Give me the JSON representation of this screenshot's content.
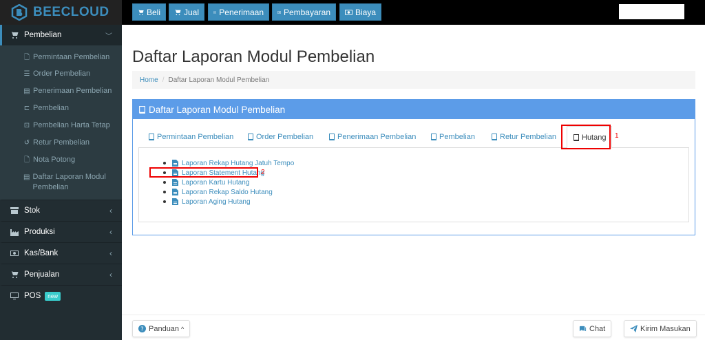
{
  "brand": "BEECLOUD",
  "topnav": [
    {
      "label": "Beli",
      "icon": "cart-icon"
    },
    {
      "label": "Jual",
      "icon": "cart-icon"
    },
    {
      "label": "Penerimaan",
      "icon": "money-icon"
    },
    {
      "label": "Pembayaran",
      "icon": "money-icon"
    },
    {
      "label": "Biaya",
      "icon": "money-icon"
    }
  ],
  "sidebar": {
    "active": {
      "label": "Pembelian",
      "chevron": "﹀"
    },
    "sub": [
      {
        "label": "Permintaan Pembelian",
        "icon": "🗋"
      },
      {
        "label": "Order Pembelian",
        "icon": "☰"
      },
      {
        "label": "Penerimaan Pembelian",
        "icon": "▤"
      },
      {
        "label": "Pembelian",
        "icon": "⊏"
      },
      {
        "label": "Pembelian Harta Tetap",
        "icon": "⊡"
      },
      {
        "label": "Retur Pembelian",
        "icon": "↺"
      },
      {
        "label": "Nota Potong",
        "icon": "🗋"
      },
      {
        "label": "Daftar Laporan Modul Pembelian",
        "icon": "▤"
      }
    ],
    "menus": [
      {
        "label": "Stok"
      },
      {
        "label": "Produksi"
      },
      {
        "label": "Kas/Bank"
      },
      {
        "label": "Penjualan"
      },
      {
        "label": "POS",
        "badge": "new"
      }
    ]
  },
  "page": {
    "title": "Daftar Laporan Modul Pembelian",
    "breadcrumb": {
      "home": "Home",
      "sep": "/",
      "current": "Daftar Laporan Modul Pembelian"
    }
  },
  "panel": {
    "title": "Daftar Laporan Modul Pembelian",
    "tabs": [
      "Permintaan Pembelian",
      "Order Pembelian",
      "Penerimaan Pembelian",
      "Pembelian",
      "Retur Pembelian",
      "Hutang"
    ],
    "active_tab": "Hutang",
    "reports": [
      "Laporan Rekap Hutang Jatuh Tempo",
      "Laporan Statement Hutang",
      "Laporan Kartu Hutang",
      "Laporan Rekap Saldo Hutang",
      "Laporan Aging Hutang"
    ]
  },
  "annotations": {
    "one": "1",
    "two": "2"
  },
  "footer": {
    "panduan": "Panduan",
    "chat": "Chat",
    "kirim": "Kirim Masukan",
    "caret": "^"
  },
  "colors": {
    "accent": "#3c8dbc",
    "panel": "#5c9ce8",
    "sidebar": "#222d32",
    "highlight": "#e00000"
  }
}
